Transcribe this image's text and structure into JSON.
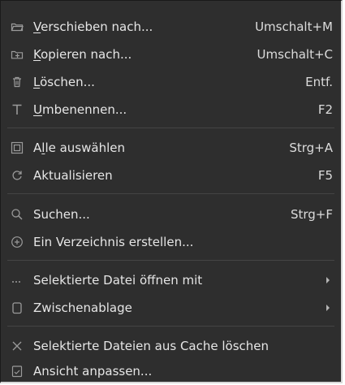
{
  "menu": {
    "items": [
      {
        "key": "move",
        "pre": "",
        "u": "V",
        "post": "erschieben nach...",
        "shortcut": "Umschalt+M",
        "icon": "folder-open-icon"
      },
      {
        "key": "copy",
        "pre": "",
        "u": "K",
        "post": "opieren nach...",
        "shortcut": "Umschalt+C",
        "icon": "copy-folder-icon"
      },
      {
        "key": "delete",
        "pre": "",
        "u": "L",
        "post": "öschen...",
        "shortcut": "Entf.",
        "icon": "trash-icon"
      },
      {
        "key": "rename",
        "pre": "",
        "u": "U",
        "post": "mbenennen...",
        "shortcut": "F2",
        "icon": "text-t-icon"
      },
      {
        "key": "selectall",
        "pre": "A",
        "u": "l",
        "post": "le auswählen",
        "shortcut": "Strg+A",
        "icon": "select-all-icon"
      },
      {
        "key": "refresh",
        "pre": "",
        "u": "",
        "post": "Aktualisieren",
        "shortcut": "F5",
        "icon": "refresh-icon"
      },
      {
        "key": "search",
        "pre": "",
        "u": "",
        "post": "Suchen...",
        "shortcut": "Strg+F",
        "icon": "search-icon"
      },
      {
        "key": "newfolder",
        "pre": "",
        "u": "",
        "post": "Ein Verzeichnis erstellen...",
        "shortcut": "",
        "icon": "plus-circle-icon"
      },
      {
        "key": "openwith",
        "pre": "",
        "u": "",
        "post": "Selektierte Datei öffnen mit",
        "shortcut": "",
        "icon": "ellipsis-icon"
      },
      {
        "key": "clipboard",
        "pre": "",
        "u": "",
        "post": "Zwischenablage",
        "shortcut": "",
        "icon": "clipboard-icon"
      },
      {
        "key": "removecache",
        "pre": "",
        "u": "",
        "post": "Selektierte Dateien aus Cache löschen",
        "shortcut": "",
        "icon": "close-x-icon"
      },
      {
        "key": "customize",
        "pre": "",
        "u": "",
        "post": "Ansicht anpassen...",
        "shortcut": "",
        "icon": "customize-view-icon"
      }
    ]
  }
}
